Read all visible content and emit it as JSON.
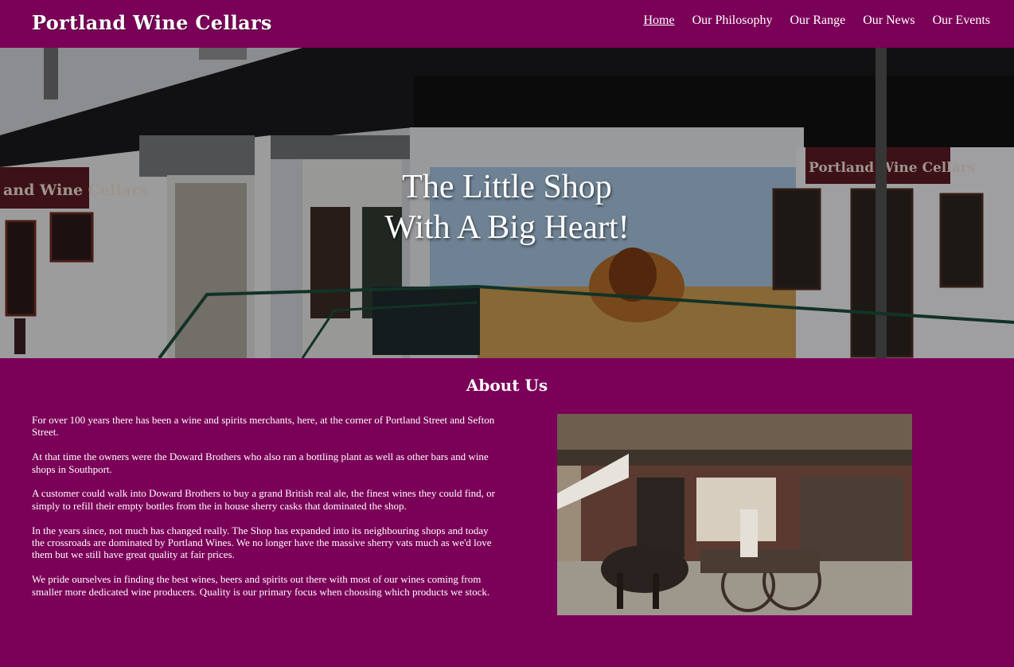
{
  "header": {
    "brand": "Portland Wine Cellars",
    "nav": [
      {
        "label": "Home",
        "active": true
      },
      {
        "label": "Our Philosophy"
      },
      {
        "label": "Our Range"
      },
      {
        "label": "Our News"
      },
      {
        "label": "Our Events"
      }
    ]
  },
  "hero": {
    "title_line1": "The Little Shop",
    "title_line2": "With A Big Heart!",
    "sign_text": "Portland Wine Cellars",
    "sign_text_left": "and Wine Cellars"
  },
  "about": {
    "heading": "About Us",
    "paragraphs": [
      "For over 100 years there has been a wine and spirits merchants, here, at the corner of Portland Street and Sefton Street.",
      "At that time the owners were the Doward Brothers who also ran a bottling plant as well as other bars and wine shops in Southport.",
      "A customer could walk into Doward Brothers to buy a grand British real ale, the finest wines they could find, or simply to refill their empty bottles from the in house sherry casks that dominated the shop.",
      "In the years since, not much has changed really. The Shop has expanded into its neighbouring shops and today the crossroads are dominated by Portland Wines. We no longer have the massive sherry vats much as we'd love them but we still have great quality at fair prices.",
      "We pride ourselves in finding the best wines, beers and spirits out there with most of our wines coming from smaller more dedicated wine producers. Quality is our primary focus when choosing which products we stock."
    ]
  },
  "colors": {
    "brand_purple": "#7b0058",
    "text": "#ffffff"
  }
}
